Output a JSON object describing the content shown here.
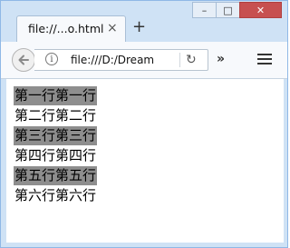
{
  "browser": {
    "tab_title": "file://...o.html",
    "tab_close_glyph": "×",
    "new_tab_glyph": "+",
    "address": "file:///D:/Dream",
    "window_controls": {
      "min": "–",
      "max": "□",
      "close": "✕"
    }
  },
  "toolbar": {
    "back_icon": "back-arrow-icon",
    "info_icon": "info-icon",
    "reload_glyph": "↻",
    "overflow_glyph": "»",
    "menu_icon": "hamburger-menu-icon"
  },
  "page": {
    "lines": [
      {
        "text": "第一行第一行",
        "highlighted": true
      },
      {
        "text": "第二行第二行",
        "highlighted": false
      },
      {
        "text": "第三行第三行",
        "highlighted": true
      },
      {
        "text": "第四行第四行",
        "highlighted": false
      },
      {
        "text": "第五行第五行",
        "highlighted": true
      },
      {
        "text": "第六行第六行",
        "highlighted": false
      }
    ]
  },
  "colors": {
    "highlight": "#8e8e8e",
    "window_frame": "#cfe2f5",
    "close_button": "#c75050"
  }
}
